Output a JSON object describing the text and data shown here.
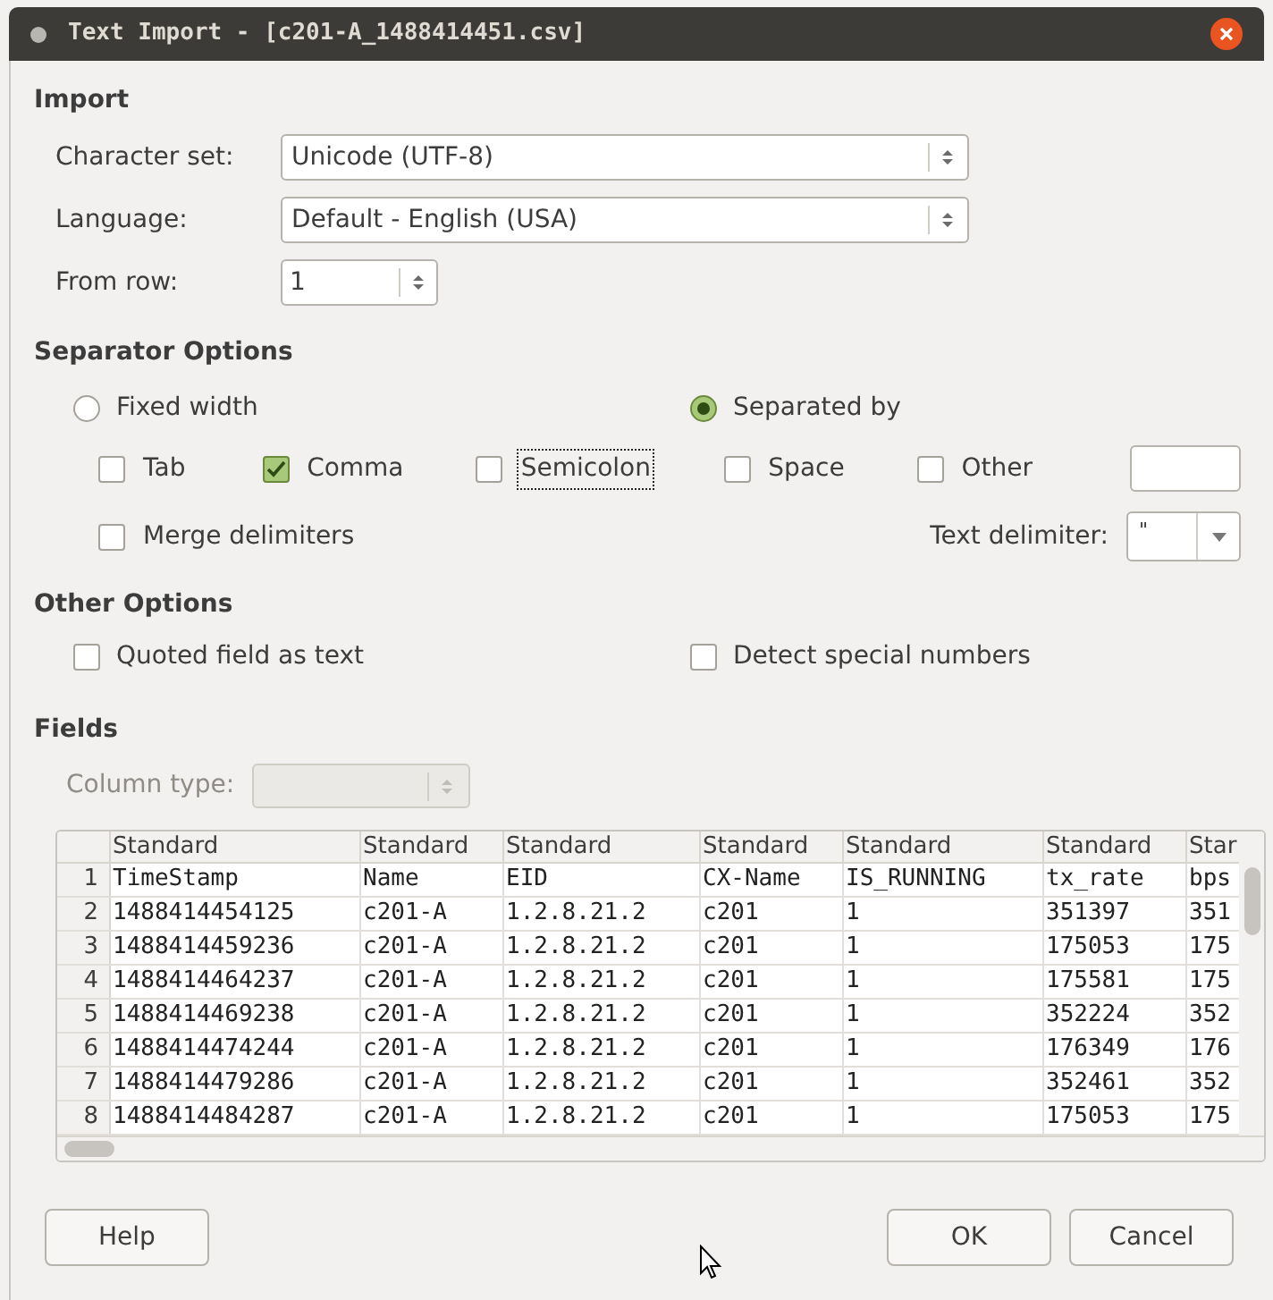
{
  "window": {
    "title": "Text Import - [c201-A_1488414451.csv]"
  },
  "import": {
    "heading": "Import",
    "fields": [
      {
        "label": "Character set:",
        "value": "Unicode (UTF-8)"
      },
      {
        "label": "Language:",
        "value": "Default - English (USA)"
      }
    ],
    "from_row": {
      "label": "From row:",
      "value": "1"
    }
  },
  "separator_options": {
    "heading": "Separator Options",
    "modes": [
      {
        "label": "Fixed width",
        "selected": false
      },
      {
        "label": "Separated by",
        "selected": true
      }
    ],
    "separators": [
      {
        "label": "Tab",
        "checked": false,
        "focused": false
      },
      {
        "label": "Comma",
        "checked": true,
        "focused": false
      },
      {
        "label": "Semicolon",
        "checked": false,
        "focused": true
      },
      {
        "label": "Space",
        "checked": false,
        "focused": false
      },
      {
        "label": "Other",
        "checked": false,
        "focused": false
      }
    ],
    "merge_delimiters": {
      "label": "Merge delimiters",
      "checked": false
    },
    "text_delimiter": {
      "label": "Text delimiter:",
      "value": "\""
    }
  },
  "other_options": {
    "heading": "Other Options",
    "options": [
      {
        "label": "Quoted field as text",
        "checked": false
      },
      {
        "label": "Detect special numbers",
        "checked": false
      }
    ]
  },
  "fields": {
    "heading": "Fields",
    "column_type": {
      "label": "Column type:",
      "disabled": true
    }
  },
  "table": {
    "columns": [
      "Standard",
      "Standard",
      "Standard",
      "Standard",
      "Standard",
      "Standard",
      "Star"
    ],
    "rows": [
      {
        "number": "1",
        "cells": [
          "TimeStamp",
          "Name",
          "EID",
          "CX-Name",
          "IS_RUNNING",
          "tx_rate",
          "bps"
        ]
      },
      {
        "number": "2",
        "cells": [
          "1488414454125",
          "c201-A",
          "1.2.8.21.2",
          "c201",
          "1",
          "351397",
          "351"
        ]
      },
      {
        "number": "3",
        "cells": [
          "1488414459236",
          "c201-A",
          "1.2.8.21.2",
          "c201",
          "1",
          "175053",
          "175"
        ]
      },
      {
        "number": "4",
        "cells": [
          "1488414464237",
          "c201-A",
          "1.2.8.21.2",
          "c201",
          "1",
          "175581",
          "175"
        ]
      },
      {
        "number": "5",
        "cells": [
          "1488414469238",
          "c201-A",
          "1.2.8.21.2",
          "c201",
          "1",
          "352224",
          "352"
        ]
      },
      {
        "number": "6",
        "cells": [
          "1488414474244",
          "c201-A",
          "1.2.8.21.2",
          "c201",
          "1",
          "176349",
          "176"
        ]
      },
      {
        "number": "7",
        "cells": [
          "1488414479286",
          "c201-A",
          "1.2.8.21.2",
          "c201",
          "1",
          "352461",
          "352"
        ]
      },
      {
        "number": "8",
        "cells": [
          "1488414484287",
          "c201-A",
          "1.2.8.21.2",
          "c201",
          "1",
          "175053",
          "175"
        ]
      }
    ]
  },
  "buttons": {
    "help": "Help",
    "ok": "OK",
    "cancel": "Cancel"
  }
}
